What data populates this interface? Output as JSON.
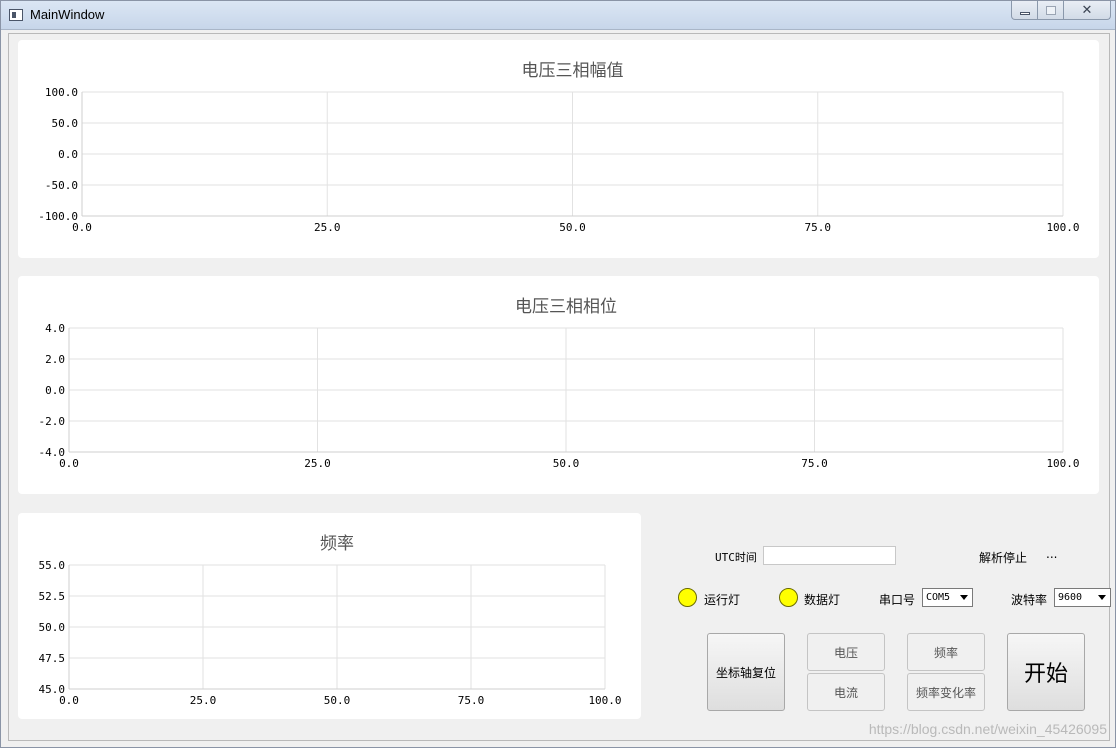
{
  "window": {
    "title": "MainWindow"
  },
  "charts": [
    {
      "id": "voltage-amplitude",
      "chart_data": {
        "type": "line",
        "title": "电压三相幅值",
        "xlim": [
          0,
          100
        ],
        "ylim": [
          -100,
          100
        ],
        "xticks": [
          "0.0",
          "25.0",
          "50.0",
          "75.0",
          "100.0"
        ],
        "yticks": [
          "100.0",
          "50.0",
          "0.0",
          "-50.0",
          "-100.0"
        ],
        "series": [],
        "grid": true
      }
    },
    {
      "id": "voltage-phase",
      "chart_data": {
        "type": "line",
        "title": "电压三相相位",
        "xlim": [
          0,
          100
        ],
        "ylim": [
          -4,
          4
        ],
        "xticks": [
          "0.0",
          "25.0",
          "50.0",
          "75.0",
          "100.0"
        ],
        "yticks": [
          "4.0",
          "2.0",
          "0.0",
          "-2.0",
          "-4.0"
        ],
        "series": [],
        "grid": true
      }
    },
    {
      "id": "frequency",
      "chart_data": {
        "type": "line",
        "title": "频率",
        "xlim": [
          0,
          100
        ],
        "ylim": [
          45,
          55
        ],
        "xticks": [
          "0.0",
          "25.0",
          "50.0",
          "75.0",
          "100.0"
        ],
        "yticks": [
          "55.0",
          "52.5",
          "50.0",
          "47.5",
          "45.0"
        ],
        "series": [],
        "grid": true
      }
    }
  ],
  "controls": {
    "utc_label": "UTC时间",
    "utc_value": "",
    "parse_status_label": "解析停止",
    "parse_status_value": "...",
    "run_led_label": "运行灯",
    "data_led_label": "数据灯",
    "led_color": "#ffff00",
    "port_label": "串口号",
    "port_value": "COM5",
    "baud_label": "波特率",
    "baud_value": "9600",
    "reset_axis_button": "坐标轴复位",
    "voltage_button": "电压",
    "current_button": "电流",
    "frequency_button": "频率",
    "freq_change_button": "频率变化率",
    "start_button": "开始"
  },
  "watermark": "https://blog.csdn.net/weixin_45426095"
}
